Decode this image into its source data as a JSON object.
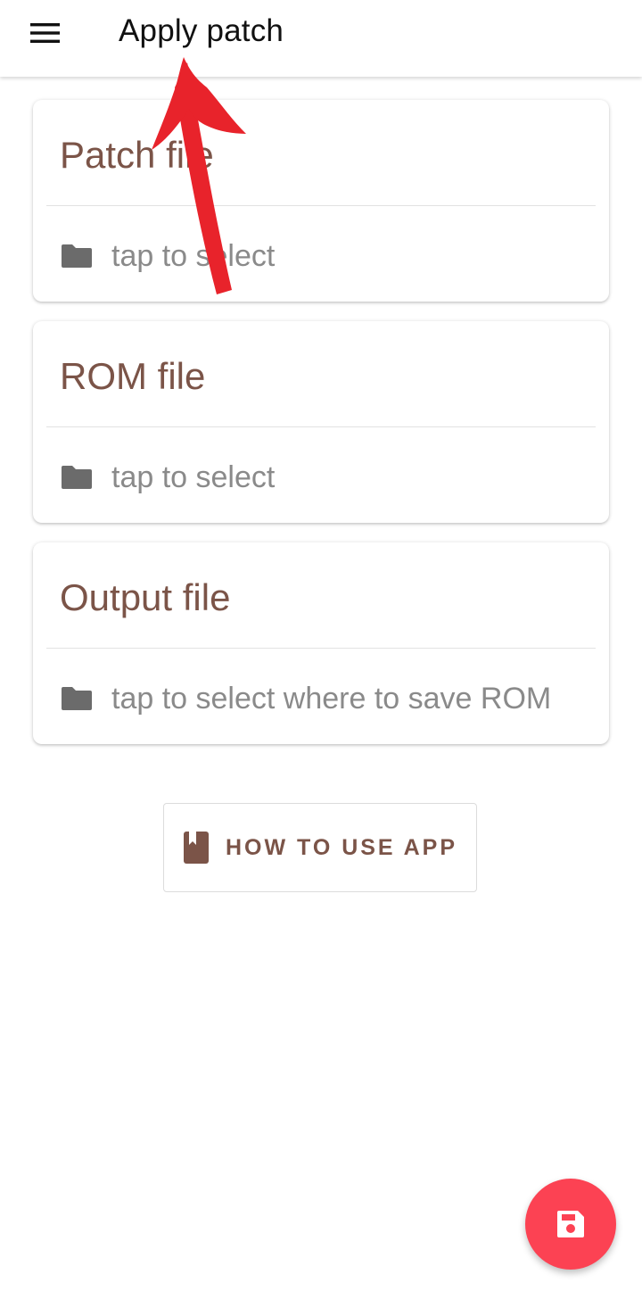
{
  "appbar": {
    "menu_icon": "hamburger-menu-icon",
    "title": "Apply patch"
  },
  "cards": [
    {
      "title": "Patch file",
      "row_label": "tap to select",
      "icon": "folder-icon"
    },
    {
      "title": "ROM file",
      "row_label": "tap to select",
      "icon": "folder-icon"
    },
    {
      "title": "Output file",
      "row_label": "tap to select where to save ROM",
      "icon": "folder-icon"
    }
  ],
  "howto_button": {
    "label": "HOW TO USE APP",
    "icon": "book-icon"
  },
  "fab": {
    "icon": "save-icon"
  },
  "annotation": {
    "icon": "red-arrow-icon"
  },
  "colors": {
    "accent": "#7b5448",
    "fab": "#fc4253",
    "annotation": "#e8232b",
    "icon_gray": "#6b6b6b"
  }
}
